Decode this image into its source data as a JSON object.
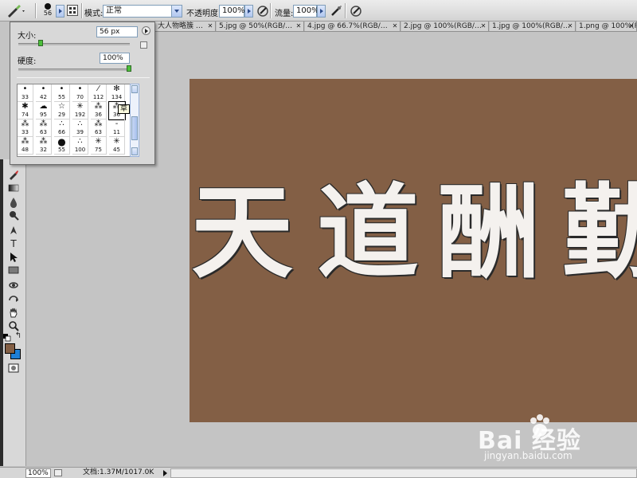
{
  "options_bar": {
    "brush_size": "56",
    "mode_label": "模式:",
    "mode_value": "正常",
    "opacity_label": "不透明度:",
    "opacity_value": "100%",
    "flow_label": "流量:",
    "flow_value": "100%"
  },
  "doc_tabs": [
    {
      "label": "大人物略簇 …"
    },
    {
      "label": "5.jpg @ 50%(RGB/…"
    },
    {
      "label": "4.jpg @ 66.7%(RGB/…"
    },
    {
      "label": "2.jpg @ 100%(RGB/…"
    },
    {
      "label": "1.jpg @ 100%(RGB/…"
    },
    {
      "label": "1.png @ 100%(RGB/…"
    }
  ],
  "brush_panel": {
    "size_label": "大小:",
    "size_value": "56 px",
    "size_slider": 0.2,
    "hardness_label": "硬度:",
    "hardness_value": "100%",
    "hardness_slider": 1.0,
    "tooltip": "草",
    "brushes": [
      {
        "num": "33",
        "icon": "dot"
      },
      {
        "num": "42",
        "icon": "dot"
      },
      {
        "num": "55",
        "icon": "dot"
      },
      {
        "num": "70",
        "icon": "dot"
      },
      {
        "num": "112",
        "icon": "stroke"
      },
      {
        "num": "134",
        "icon": "grass"
      },
      {
        "num": "74",
        "icon": "leaf"
      },
      {
        "num": "95",
        "icon": "cloud"
      },
      {
        "num": "29",
        "icon": "star"
      },
      {
        "num": "192",
        "icon": "spark"
      },
      {
        "num": "36",
        "icon": "cluster"
      },
      {
        "num": "36",
        "icon": "cluster"
      },
      {
        "num": "33",
        "icon": "cluster"
      },
      {
        "num": "63",
        "icon": "cluster"
      },
      {
        "num": "66",
        "icon": "dots"
      },
      {
        "num": "39",
        "icon": "dots"
      },
      {
        "num": "63",
        "icon": "cluster"
      },
      {
        "num": "11",
        "icon": "dash"
      },
      {
        "num": "48",
        "icon": "cluster"
      },
      {
        "num": "32",
        "icon": "cluster"
      },
      {
        "num": "55",
        "icon": "circle"
      },
      {
        "num": "100",
        "icon": "dots"
      },
      {
        "num": "75",
        "icon": "spark"
      },
      {
        "num": "45",
        "icon": "spark"
      }
    ]
  },
  "canvas": {
    "background_color": "#835f45",
    "characters": [
      "天",
      "道",
      "酬",
      "勤"
    ]
  },
  "status_bar": {
    "zoom": "100%",
    "doc_info": "文档:1.37M/1017.0K"
  },
  "watermark": {
    "text": "Bai 经验",
    "subtext": "jingyan.baidu.com"
  },
  "colors": {
    "foreground": "#835f45",
    "background": "#1e7fd6",
    "slider_knob": "#4cbf3a"
  }
}
